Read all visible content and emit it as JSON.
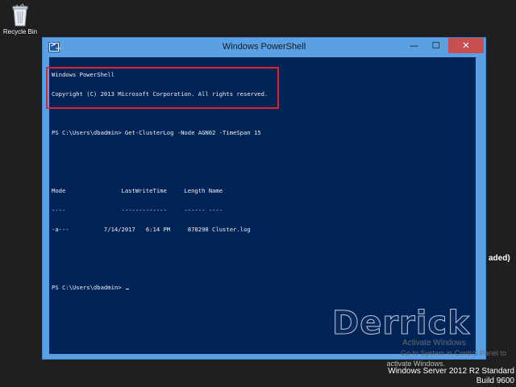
{
  "desktop": {
    "recycle_bin_label": "Recycle Bin",
    "background_fragment": "aded)",
    "activate_line1": "Activate Windows",
    "activate_line2": "Go to System in Control Panel to",
    "activate_line3": "activate Windows.",
    "os_name": "Windows Server 2012 R2 Standard",
    "build": "Build 9600",
    "logo_text": "Derrick"
  },
  "window": {
    "title": "Windows PowerShell",
    "icon_glyph": ">_",
    "minimize_glyph": "—",
    "maximize_glyph": "☐",
    "close_glyph": "✕"
  },
  "console": {
    "banner1": "Windows PowerShell",
    "banner2": "Copyright (C) 2013 Microsoft Corporation. All rights reserved.",
    "command": "PS C:\\Users\\dbadmin> Get-ClusterLog -Node AGN02 -TimeSpan 15",
    "header": "Mode                LastWriteTime     Length Name",
    "underline": "----                -------------     ------ ----",
    "row": "-a---          7/14/2017   6:14 PM     878298 Cluster.log",
    "prompt": "PS C:\\Users\\dbadmin> "
  },
  "colors": {
    "console_bg": "#012456",
    "window_frame": "#5aa0e3",
    "highlight": "#e2242a"
  }
}
